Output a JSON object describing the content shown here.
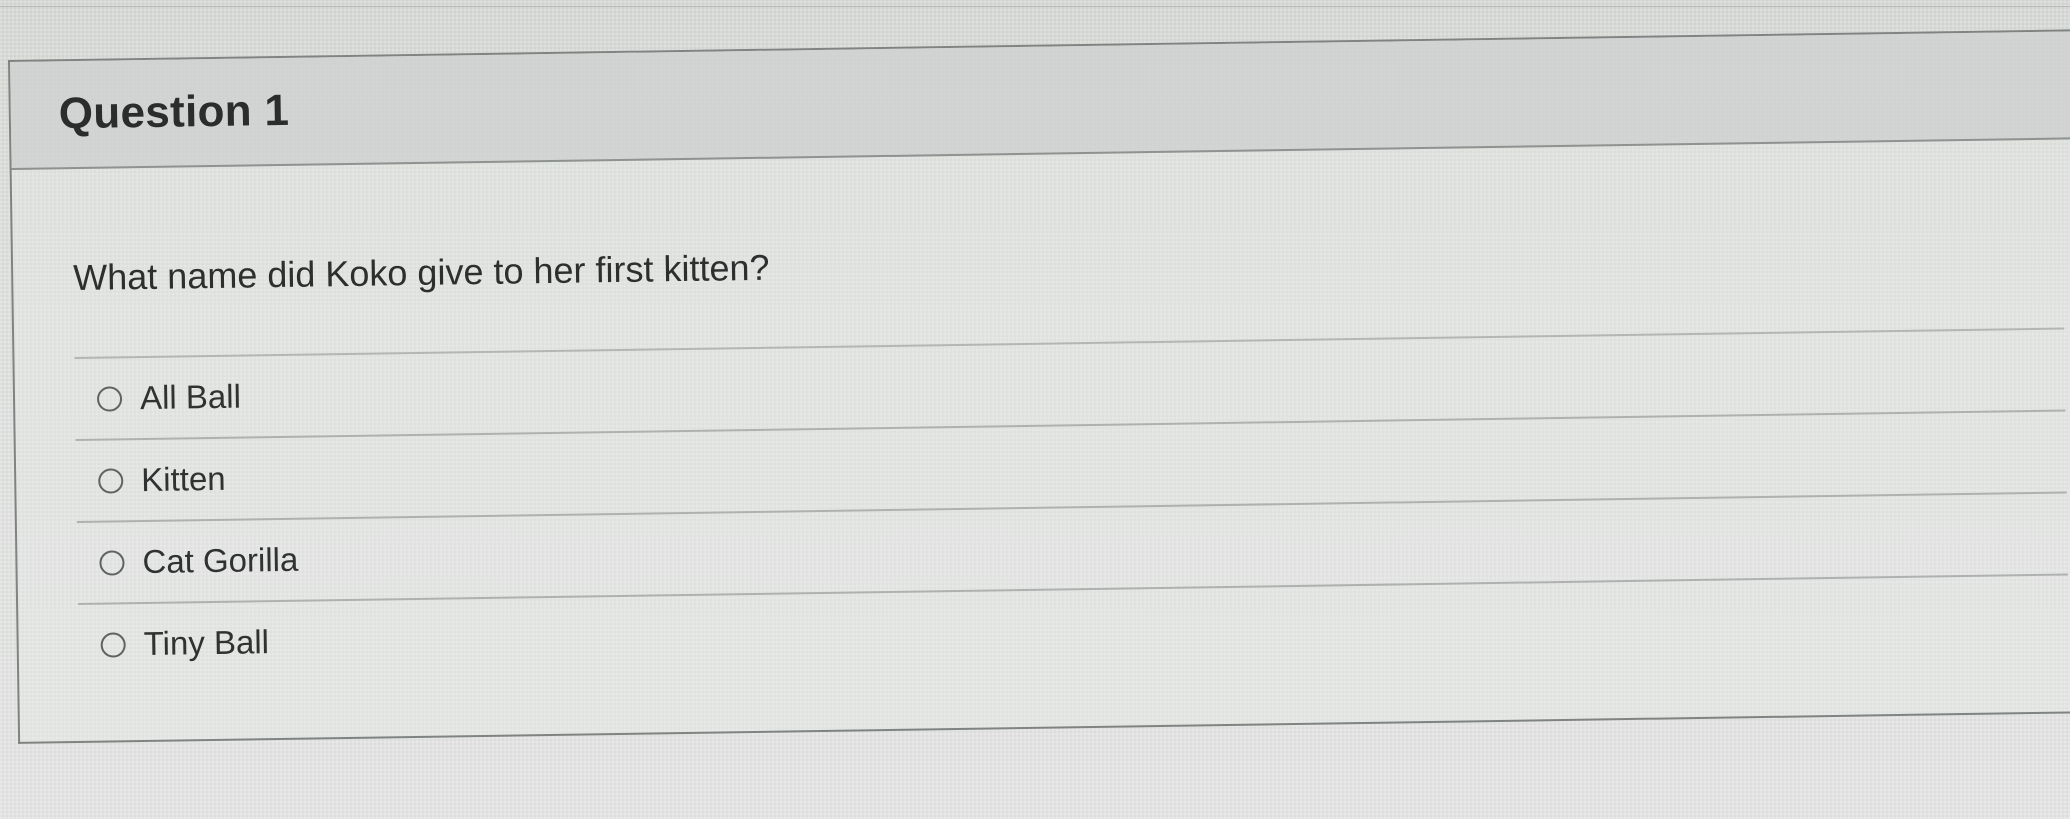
{
  "question": {
    "title": "Question 1",
    "text": "What name did Koko give to her first kitten?",
    "answers": [
      {
        "label": "All Ball"
      },
      {
        "label": "Kitten"
      },
      {
        "label": "Cat Gorilla"
      },
      {
        "label": "Tiny Ball"
      }
    ]
  },
  "colors": {
    "border": "#7f8381",
    "header_background": "#cccfcd",
    "text": "#2d2f2e"
  }
}
